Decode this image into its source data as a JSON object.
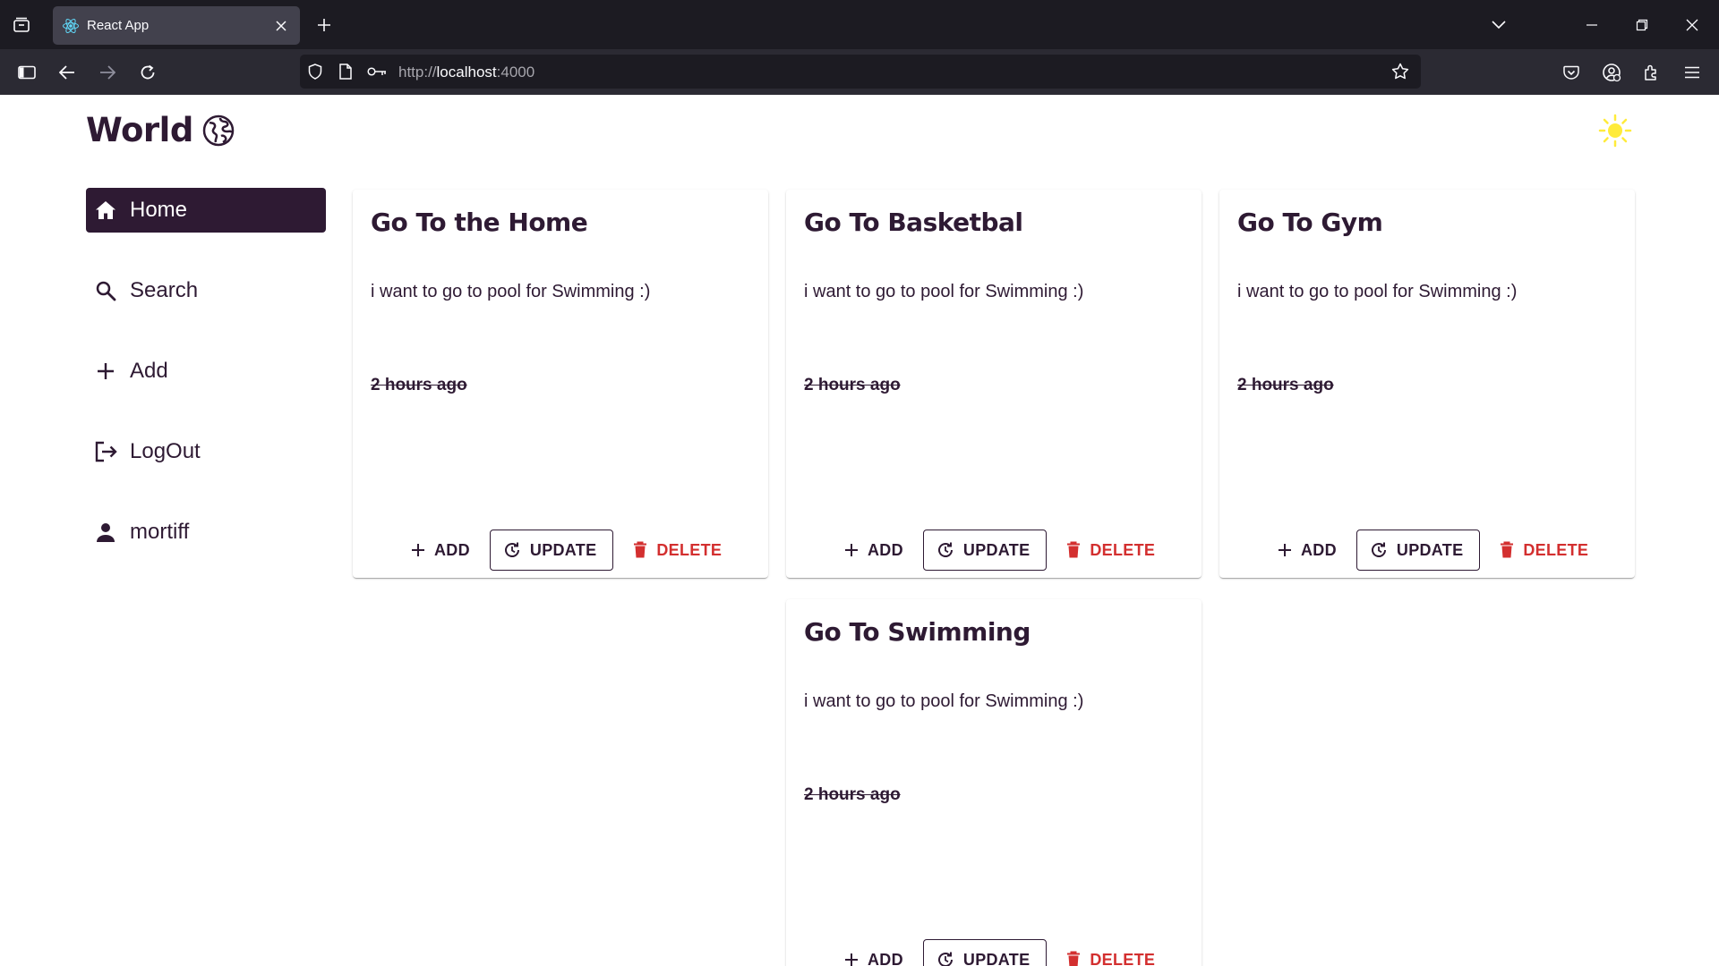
{
  "browser": {
    "tab_title": "React App",
    "url_prefix": "http://",
    "url_host": "localhost",
    "url_port": ":4000"
  },
  "app": {
    "logo_text": "World",
    "sidebar": {
      "items": [
        {
          "label": "Home",
          "icon": "home-icon",
          "active": true
        },
        {
          "label": "Search",
          "icon": "search-icon",
          "active": false
        },
        {
          "label": "Add",
          "icon": "plus-icon",
          "active": false
        },
        {
          "label": "LogOut",
          "icon": "logout-icon",
          "active": false
        },
        {
          "label": "mortiff",
          "icon": "user-icon",
          "active": false
        }
      ]
    },
    "cards": [
      {
        "title": "Go To the Home",
        "description": "i want to go to pool for Swimming :)",
        "time": "2 hours ago",
        "add_label": "ADD",
        "update_label": "UPDATE",
        "delete_label": "DELETE"
      },
      {
        "title": "Go To Basketbal",
        "description": "i want to go to pool for Swimming :)",
        "time": "2 hours ago",
        "add_label": "ADD",
        "update_label": "UPDATE",
        "delete_label": "DELETE"
      },
      {
        "title": "Go To Gym",
        "description": "i want to go to pool for Swimming :)",
        "time": "2 hours ago",
        "add_label": "ADD",
        "update_label": "UPDATE",
        "delete_label": "DELETE"
      },
      {
        "title": "Go To Swimming",
        "description": "i want to go to pool for Swimming :)",
        "time": "2 hours ago",
        "add_label": "ADD",
        "update_label": "UPDATE",
        "delete_label": "DELETE"
      }
    ]
  },
  "colors": {
    "primary": "#2e1a33",
    "danger": "#d32f2f",
    "sun": "#ffeb3b",
    "browser_tabbar": "#1c1b22",
    "browser_toolbar": "#2b2a33"
  }
}
